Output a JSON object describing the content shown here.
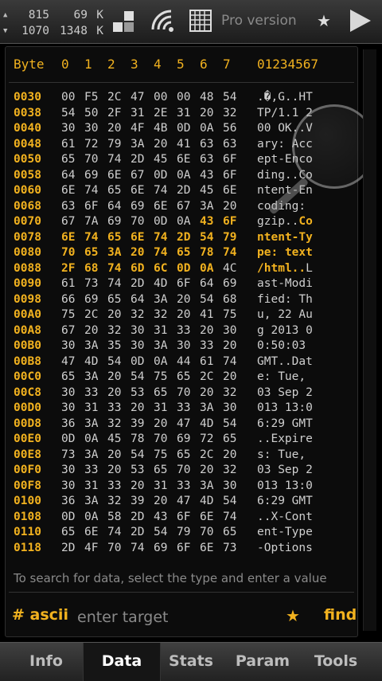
{
  "status": {
    "up": {
      "a": "815",
      "b": "69",
      "unit": "K"
    },
    "down": {
      "a": "1070",
      "b": "1348",
      "unit": "K"
    },
    "pro_label": "Pro version"
  },
  "header": {
    "byte_label": "Byte",
    "cols": [
      "0",
      "1",
      "2",
      "3",
      "4",
      "5",
      "6",
      "7"
    ],
    "ascii_label": "01234567"
  },
  "rows": [
    {
      "off": "0030",
      "hex": [
        "00",
        "F5",
        "2C",
        "47",
        "00",
        "00",
        "48",
        "54"
      ],
      "ascii": ".�,G..HT",
      "sel": [],
      "asel": ""
    },
    {
      "off": "0038",
      "hex": [
        "54",
        "50",
        "2F",
        "31",
        "2E",
        "31",
        "20",
        "32"
      ],
      "ascii": "TP/1.1 2",
      "sel": [],
      "asel": ""
    },
    {
      "off": "0040",
      "hex": [
        "30",
        "30",
        "20",
        "4F",
        "4B",
        "0D",
        "0A",
        "56"
      ],
      "ascii": "00 OK..V",
      "sel": [],
      "asel": ""
    },
    {
      "off": "0048",
      "hex": [
        "61",
        "72",
        "79",
        "3A",
        "20",
        "41",
        "63",
        "63"
      ],
      "ascii": "ary: Acc",
      "sel": [],
      "asel": ""
    },
    {
      "off": "0050",
      "hex": [
        "65",
        "70",
        "74",
        "2D",
        "45",
        "6E",
        "63",
        "6F"
      ],
      "ascii": "ept-Enco",
      "sel": [],
      "asel": ""
    },
    {
      "off": "0058",
      "hex": [
        "64",
        "69",
        "6E",
        "67",
        "0D",
        "0A",
        "43",
        "6F"
      ],
      "ascii": "ding..Co",
      "sel": [],
      "asel": ""
    },
    {
      "off": "0060",
      "hex": [
        "6E",
        "74",
        "65",
        "6E",
        "74",
        "2D",
        "45",
        "6E"
      ],
      "ascii": "ntent-En",
      "sel": [],
      "asel": ""
    },
    {
      "off": "0068",
      "hex": [
        "63",
        "6F",
        "64",
        "69",
        "6E",
        "67",
        "3A",
        "20"
      ],
      "ascii": "coding: ",
      "sel": [],
      "asel": ""
    },
    {
      "off": "0070",
      "hex": [
        "67",
        "7A",
        "69",
        "70",
        "0D",
        "0A",
        "43",
        "6F"
      ],
      "ascii": "gzip..Co",
      "sel": [
        6,
        7
      ],
      "asel": "gzip..|Co"
    },
    {
      "off": "0078",
      "hex": [
        "6E",
        "74",
        "65",
        "6E",
        "74",
        "2D",
        "54",
        "79"
      ],
      "ascii": "ntent-Ty",
      "sel": [
        0,
        1,
        2,
        3,
        4,
        5,
        6,
        7
      ],
      "asel": "|ntent-Ty"
    },
    {
      "off": "0080",
      "hex": [
        "70",
        "65",
        "3A",
        "20",
        "74",
        "65",
        "78",
        "74"
      ],
      "ascii": "pe: text",
      "sel": [
        0,
        1,
        2,
        3,
        4,
        5,
        6,
        7
      ],
      "asel": "|pe: text"
    },
    {
      "off": "0088",
      "hex": [
        "2F",
        "68",
        "74",
        "6D",
        "6C",
        "0D",
        "0A",
        "4C"
      ],
      "ascii": "/html..L",
      "sel": [
        0,
        1,
        2,
        3,
        4,
        5,
        6
      ],
      "asel": "|/html..|L"
    },
    {
      "off": "0090",
      "hex": [
        "61",
        "73",
        "74",
        "2D",
        "4D",
        "6F",
        "64",
        "69"
      ],
      "ascii": "ast-Modi",
      "sel": [],
      "asel": ""
    },
    {
      "off": "0098",
      "hex": [
        "66",
        "69",
        "65",
        "64",
        "3A",
        "20",
        "54",
        "68"
      ],
      "ascii": "fied: Th",
      "sel": [],
      "asel": ""
    },
    {
      "off": "00A0",
      "hex": [
        "75",
        "2C",
        "20",
        "32",
        "32",
        "20",
        "41",
        "75"
      ],
      "ascii": "u, 22 Au",
      "sel": [],
      "asel": ""
    },
    {
      "off": "00A8",
      "hex": [
        "67",
        "20",
        "32",
        "30",
        "31",
        "33",
        "20",
        "30"
      ],
      "ascii": "g 2013 0",
      "sel": [],
      "asel": ""
    },
    {
      "off": "00B0",
      "hex": [
        "30",
        "3A",
        "35",
        "30",
        "3A",
        "30",
        "33",
        "20"
      ],
      "ascii": "0:50:03 ",
      "sel": [],
      "asel": ""
    },
    {
      "off": "00B8",
      "hex": [
        "47",
        "4D",
        "54",
        "0D",
        "0A",
        "44",
        "61",
        "74"
      ],
      "ascii": "GMT..Dat",
      "sel": [],
      "asel": ""
    },
    {
      "off": "00C0",
      "hex": [
        "65",
        "3A",
        "20",
        "54",
        "75",
        "65",
        "2C",
        "20"
      ],
      "ascii": "e: Tue, ",
      "sel": [],
      "asel": ""
    },
    {
      "off": "00C8",
      "hex": [
        "30",
        "33",
        "20",
        "53",
        "65",
        "70",
        "20",
        "32"
      ],
      "ascii": "03 Sep 2",
      "sel": [],
      "asel": ""
    },
    {
      "off": "00D0",
      "hex": [
        "30",
        "31",
        "33",
        "20",
        "31",
        "33",
        "3A",
        "30"
      ],
      "ascii": "013 13:0",
      "sel": [],
      "asel": ""
    },
    {
      "off": "00D8",
      "hex": [
        "36",
        "3A",
        "32",
        "39",
        "20",
        "47",
        "4D",
        "54"
      ],
      "ascii": "6:29 GMT",
      "sel": [],
      "asel": ""
    },
    {
      "off": "00E0",
      "hex": [
        "0D",
        "0A",
        "45",
        "78",
        "70",
        "69",
        "72",
        "65"
      ],
      "ascii": "..Expire",
      "sel": [],
      "asel": ""
    },
    {
      "off": "00E8",
      "hex": [
        "73",
        "3A",
        "20",
        "54",
        "75",
        "65",
        "2C",
        "20"
      ],
      "ascii": "s: Tue, ",
      "sel": [],
      "asel": ""
    },
    {
      "off": "00F0",
      "hex": [
        "30",
        "33",
        "20",
        "53",
        "65",
        "70",
        "20",
        "32"
      ],
      "ascii": "03 Sep 2",
      "sel": [],
      "asel": ""
    },
    {
      "off": "00F8",
      "hex": [
        "30",
        "31",
        "33",
        "20",
        "31",
        "33",
        "3A",
        "30"
      ],
      "ascii": "013 13:0",
      "sel": [],
      "asel": ""
    },
    {
      "off": "0100",
      "hex": [
        "36",
        "3A",
        "32",
        "39",
        "20",
        "47",
        "4D",
        "54"
      ],
      "ascii": "6:29 GMT",
      "sel": [],
      "asel": ""
    },
    {
      "off": "0108",
      "hex": [
        "0D",
        "0A",
        "58",
        "2D",
        "43",
        "6F",
        "6E",
        "74"
      ],
      "ascii": "..X-Cont",
      "sel": [],
      "asel": ""
    },
    {
      "off": "0110",
      "hex": [
        "65",
        "6E",
        "74",
        "2D",
        "54",
        "79",
        "70",
        "65"
      ],
      "ascii": "ent-Type",
      "sel": [],
      "asel": ""
    },
    {
      "off": "0118",
      "hex": [
        "2D",
        "4F",
        "70",
        "74",
        "69",
        "6F",
        "6E",
        "73"
      ],
      "ascii": "-Options",
      "sel": [],
      "asel": ""
    }
  ],
  "search": {
    "hint": "To search for data, select the type and enter a value",
    "type_label": "# ascii",
    "placeholder": "enter target",
    "find_label": "find"
  },
  "tabs": [
    {
      "label": "Info",
      "active": false
    },
    {
      "label": "Data",
      "active": true
    },
    {
      "label": "Stats",
      "active": false
    },
    {
      "label": "Param",
      "active": false
    },
    {
      "label": "Tools",
      "active": false
    }
  ],
  "colors": {
    "accent": "#f2b21f",
    "text": "#cfcfcf",
    "background": "#000000"
  }
}
